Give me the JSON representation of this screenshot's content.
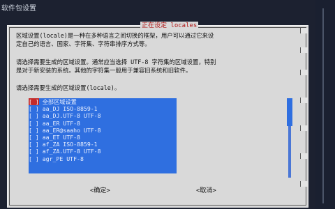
{
  "window": {
    "title": "软件包设置"
  },
  "dialog": {
    "title": "正在设定 locales",
    "paragraph1": "区域设置(locale)是一种在多种语言之间切换的框架，用户可以通过它来设\n定自己的语言、国家、字符集、字符串排序方式等。",
    "paragraph2": "请选择需要生成的区域设置。通常应当选择 UTF-8 字符集的区域设置，特别\n是对于新安装的系统。其他的字符集一般用于兼容旧系统和旧软件。",
    "prompt": "请选择需要生成的区域设置(locale)。",
    "items": [
      {
        "checkbox": "[ ]",
        "label": "全部区域设置"
      },
      {
        "checkbox": "[ ]",
        "label": "aa_DJ ISO-8859-1"
      },
      {
        "checkbox": "[ ]",
        "label": "aa_DJ.UTF-8 UTF-8"
      },
      {
        "checkbox": "[ ]",
        "label": "aa_ER UTF-8"
      },
      {
        "checkbox": "[ ]",
        "label": "aa_ER@saaho UTF-8"
      },
      {
        "checkbox": "[ ]",
        "label": "aa_ET UTF-8"
      },
      {
        "checkbox": "[ ]",
        "label": "af_ZA ISO-8859-1"
      },
      {
        "checkbox": "[ ]",
        "label": "af_ZA.UTF-8 UTF-8"
      },
      {
        "checkbox": "[ ]",
        "label": "agr_PE UTF-8"
      }
    ],
    "ok_label": "<确定>",
    "cancel_label": "<取消>"
  },
  "colors": {
    "list_bg": "#2f6fe0",
    "title_red": "#b01818",
    "dialog_bg": "#d9d9d9"
  }
}
